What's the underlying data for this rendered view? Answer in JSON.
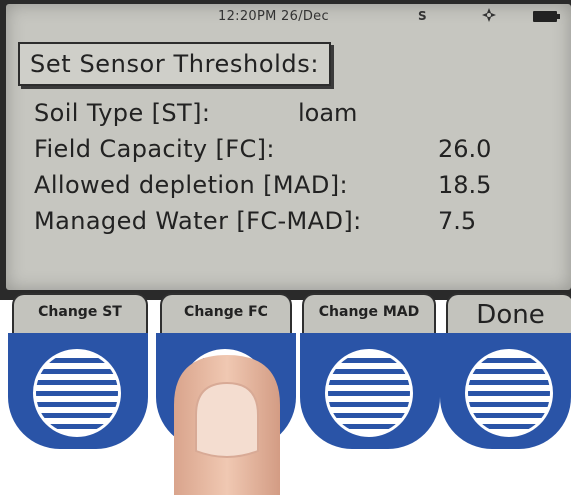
{
  "status": {
    "time_date": "12:20PM 26/Dec",
    "indicator": "S",
    "icons": [
      "gps-icon",
      "battery-icon"
    ]
  },
  "screen": {
    "title": "Set Sensor Thresholds:",
    "soil_type": {
      "label": "Soil Type [ST]:",
      "value": "loam"
    },
    "field_capacity": {
      "label": "Field Capacity [FC]:",
      "value": "26.0"
    },
    "allowed_depletion": {
      "label": "Allowed depletion [MAD]:",
      "value": "18.5"
    },
    "managed_water": {
      "label": "Managed Water [FC-MAD]:",
      "value": "7.5"
    }
  },
  "softkeys": {
    "change_st": "Change ST",
    "change_fc": "Change FC",
    "change_mad": "Change MAD",
    "done": "Done"
  },
  "colors": {
    "button_blue": "#2a54a7",
    "lcd": "#c6c6c0"
  }
}
